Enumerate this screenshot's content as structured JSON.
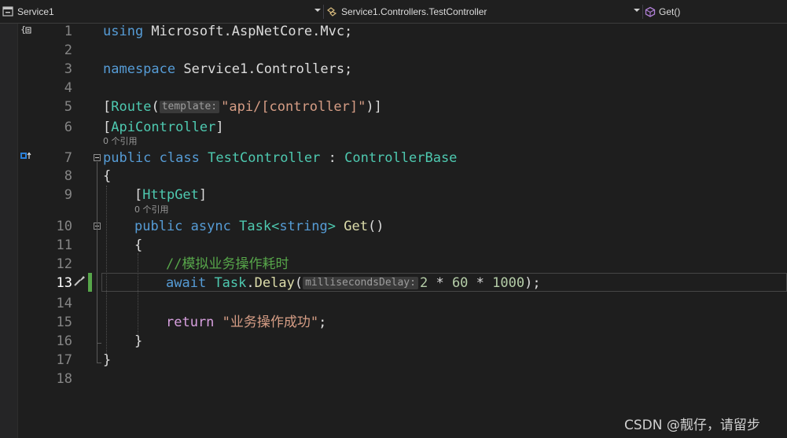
{
  "navbar": {
    "project": "Service1",
    "class_path": "Service1.Controllers.TestController",
    "member": "Get()"
  },
  "line_numbers": [
    "1",
    "2",
    "3",
    "4",
    "5",
    "6",
    "7",
    "8",
    "9",
    "10",
    "11",
    "12",
    "13",
    "14",
    "15",
    "16",
    "17",
    "18"
  ],
  "code": {
    "l1_kw": "using",
    "l1_ns": " Microsoft.AspNetCore.Mvc;",
    "l3_kw": "namespace",
    "l3_ns": " Service1.Controllers;",
    "l5_open": "[",
    "l5_attr": "Route",
    "l5_paren": "(",
    "l5_hint": "template:",
    "l5_str": "\"api/[controller]\"",
    "l5_close": ")]",
    "l6_open": "[",
    "l6_attr": "ApiController",
    "l6_close": "]",
    "lens_class": "0 个引用",
    "l7_kw1": "public",
    "l7_kw2": "class",
    "l7_name": "TestController",
    "l7_colon": " : ",
    "l7_base": "ControllerBase",
    "l8_brace": "{",
    "l9_open": "[",
    "l9_attr": "HttpGet",
    "l9_close": "]",
    "lens_method": "0 个引用",
    "l10_kw1": "public",
    "l10_kw2": "async",
    "l10_type": "Task",
    "l10_lt": "<",
    "l10_kw3": "string",
    "l10_gt": ">",
    "l10_method": "Get",
    "l10_parens": "()",
    "l11_brace": "{",
    "l12_comment": "//模拟业务操作耗时",
    "l13_kw": "await",
    "l13_type": "Task",
    "l13_dot": ".",
    "l13_method": "Delay",
    "l13_paren": "(",
    "l13_hint": "millisecondsDelay:",
    "l13_n1": "2",
    "l13_op1": " * ",
    "l13_n2": "60",
    "l13_op2": " * ",
    "l13_n3": "1000",
    "l13_end": ");",
    "l15_kw": "return",
    "l15_str": "\"业务操作成功\"",
    "l15_end": ";",
    "l16_brace": "}",
    "l17_brace": "}"
  },
  "watermark": "CSDN @靓仔，请留步",
  "colors": {
    "keyword": "#569cd6",
    "type": "#4ec9b0",
    "string": "#d69d85",
    "comment": "#57a64a",
    "number": "#b5cea8",
    "control": "#d8a0df",
    "method": "#dcdcaa",
    "change_bar": "#57a64a"
  }
}
